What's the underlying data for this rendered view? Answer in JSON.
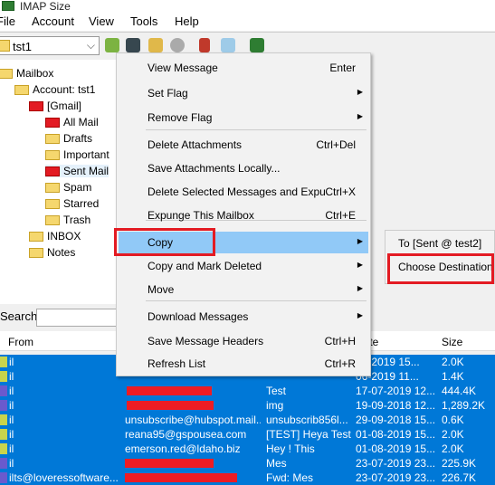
{
  "window": {
    "title": "IMAP Size"
  },
  "menubar": [
    "File",
    "Account",
    "View",
    "Tools",
    "Help"
  ],
  "toolbar": {
    "account": "tst1",
    "icons": [
      "connect-icon",
      "disconnect-icon",
      "open-folder-icon",
      "stop-icon",
      "sort-icon",
      "find-icon",
      "settings-icon"
    ]
  },
  "tree": {
    "root": "Mailbox",
    "account": "Account: tst1",
    "gmail": "[Gmail]",
    "gmail_children": [
      "All Mail",
      "Drafts",
      "Important",
      "Sent Mail",
      "Spam",
      "Starred",
      "Trash"
    ],
    "others": [
      "INBOX",
      "Notes"
    ]
  },
  "search": {
    "label": "Search",
    "value": ""
  },
  "table": {
    "headers": [
      "From",
      "Date",
      "Size"
    ],
    "rows": [
      {
        "from": "il",
        "email": "",
        "subject": "",
        "date": "08-2019 15...",
        "size": "2.0K"
      },
      {
        "from": "il",
        "email": "",
        "subject": "",
        "date": "06-2019 11...",
        "size": "1.4K"
      },
      {
        "from": "il",
        "email": "",
        "subject": "Test",
        "date": "17-07-2019 12...",
        "size": "444.4K"
      },
      {
        "from": "il",
        "email": "",
        "subject": "img",
        "date": "19-09-2018 12...",
        "size": "1,289.2K"
      },
      {
        "from": "il",
        "email": "unsubscribe@hubspot.mail....",
        "subject": "unsubscrib856l...",
        "date": "29-09-2018 15...",
        "size": "0.6K"
      },
      {
        "from": "il",
        "email": "reana95@gspousea.com",
        "subject": "[TEST] Heya Test",
        "date": "01-08-2019 15...",
        "size": "2.0K"
      },
      {
        "from": "il",
        "email": "emerson.red@ldaho.biz",
        "subject": "Hey ! This",
        "date": "01-08-2019 15...",
        "size": "2.0K"
      },
      {
        "from": "il",
        "email": "",
        "subject": "Mes",
        "date": "23-07-2019 23...",
        "size": "225.9K"
      },
      {
        "from": "ilts@loveressoftware...",
        "email": "",
        "subject": "Fwd: Mes",
        "date": "23-07-2019 23...",
        "size": "226.7K"
      }
    ]
  },
  "context_menu": [
    {
      "label": "View Message",
      "shortcut": "Enter"
    },
    {
      "label": "Set Flag",
      "submenu": true
    },
    {
      "label": "Remove Flag",
      "submenu": true
    },
    {
      "label": "Delete Attachments",
      "shortcut": "Ctrl+Del"
    },
    {
      "label": "Save Attachments Locally..."
    },
    {
      "label": "Delete Selected Messages and Expu",
      "shortcut": "Ctrl+X"
    },
    {
      "label": "Expunge This Mailbox",
      "shortcut": "Ctrl+E"
    },
    {
      "label": "Copy",
      "submenu": true,
      "highlighted": true
    },
    {
      "label": "Copy and Mark Deleted",
      "submenu": true
    },
    {
      "label": "Move",
      "submenu": true
    },
    {
      "label": "Download Messages",
      "submenu": true
    },
    {
      "label": "Save Message Headers",
      "shortcut": "Ctrl+H"
    },
    {
      "label": "Refresh List",
      "shortcut": "Ctrl+R"
    }
  ],
  "copy_submenu": [
    "To [Sent @ test2]",
    "Choose Destination"
  ],
  "colors": {
    "selection": "#0078d7",
    "menu_highlight": "#91c9f7",
    "annotation": "#e31b23"
  }
}
